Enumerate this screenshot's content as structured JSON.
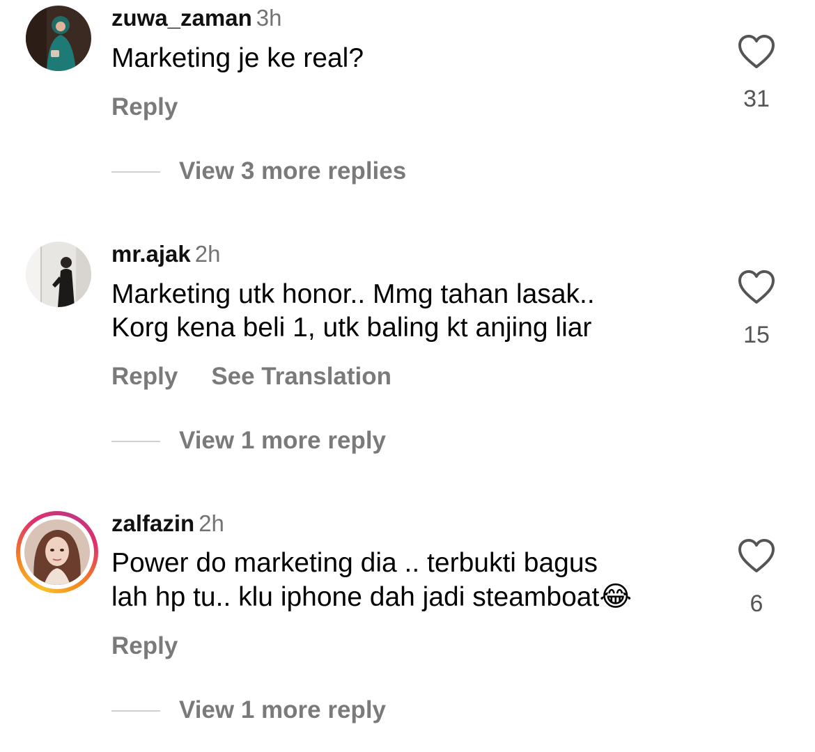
{
  "comments": [
    {
      "username": "zuwa_zaman",
      "time": "3h",
      "lines": [
        "Marketing je ke real?"
      ],
      "like_count": "31",
      "reply_label": "Reply",
      "view_replies": "View 3 more replies",
      "avatar": "profile-photo"
    },
    {
      "username": "mr.ajak",
      "time": "2h",
      "lines": [
        "Marketing utk honor.. Mmg tahan lasak..",
        "Korg kena beli 1, utk baling kt anjing liar"
      ],
      "like_count": "15",
      "reply_label": "Reply",
      "translation_label": "See Translation",
      "view_replies": "View 1 more reply",
      "avatar": "profile-photo"
    },
    {
      "username": "zalfazin",
      "time": "2h",
      "lines": [
        "Power do marketing dia .. terbukti bagus",
        "lah hp tu.. klu iphone dah jadi steamboat"
      ],
      "emoji": "😂",
      "like_count": "6",
      "reply_label": "Reply",
      "view_replies": "View 1 more reply",
      "avatar": "profile-photo-story-ring"
    }
  ],
  "icons": {
    "like": "heart-outline-icon"
  },
  "colors": {
    "secondary_text": "#737373",
    "action_text": "#7a7a7a",
    "story_ring": [
      "#f9c02b",
      "#e1306c",
      "#c13584"
    ]
  }
}
